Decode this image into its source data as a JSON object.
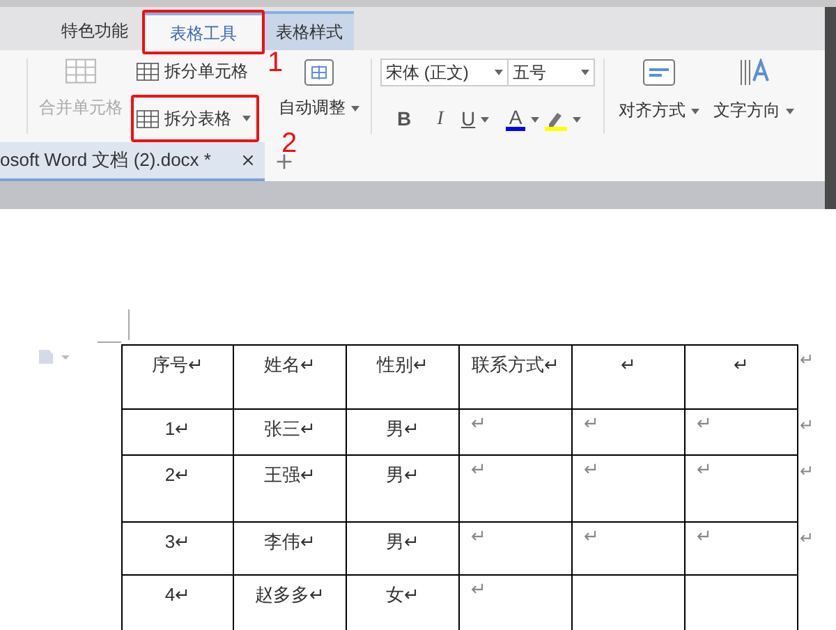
{
  "tabs": [
    {
      "label": "特色功能",
      "selected": false
    },
    {
      "label": "表格工具",
      "selected": true
    },
    {
      "label": "表格样式",
      "selected": false
    }
  ],
  "ribbon": {
    "merge_cells": {
      "label": "合并单元格",
      "disabled": true
    },
    "split_cells": {
      "label": "拆分单元格",
      "disabled": false
    },
    "split_table": {
      "label": "拆分表格",
      "disabled": false
    },
    "autofit": {
      "label": "自动调整"
    },
    "font_name": {
      "value": "宋体 (正文)"
    },
    "font_size": {
      "value": "五号"
    },
    "bold": "B",
    "italic": "I",
    "underline": "U",
    "font_color": {
      "label": "A",
      "color": "#0000ff"
    },
    "highlight": {
      "color": "#ffff00"
    },
    "align": "对齐方式",
    "direction": "文字方向"
  },
  "document_tab": {
    "title": "osoft Word 文档 (2).docx *"
  },
  "table": {
    "rows": [
      [
        "序号↵",
        "姓名↵",
        "性别↵",
        "联系方式↵",
        "↵",
        "↵"
      ],
      [
        "1↵",
        "张三↵",
        "男↵",
        "↵",
        "↵",
        "↵"
      ],
      [
        "2↵",
        "王强↵",
        "男↵",
        "↵",
        "↵",
        "↵"
      ],
      [
        "3↵",
        "李伟↵",
        "男↵",
        "↵",
        "↵",
        "↵"
      ],
      [
        "4↵",
        "赵多多↵",
        "女↵",
        "↵",
        "",
        ""
      ]
    ],
    "row_ends": [
      "↵",
      "↵",
      "↵",
      "↵"
    ]
  },
  "annotations": [
    {
      "label": "1"
    },
    {
      "label": "2"
    }
  ]
}
